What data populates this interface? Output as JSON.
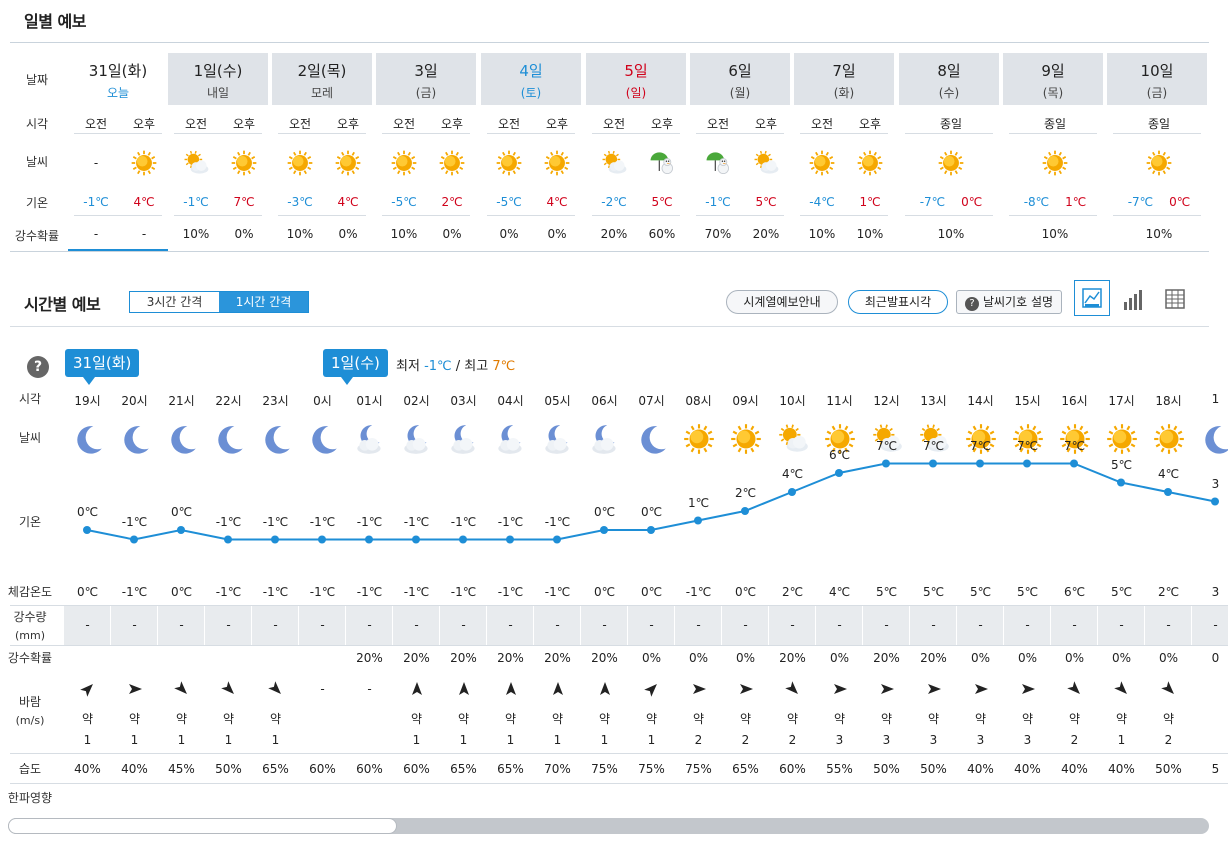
{
  "daily": {
    "title": "일별 예보",
    "labels": {
      "date": "날짜",
      "time": "시각",
      "weather": "날씨",
      "temp": "기온",
      "rain": "강수확률"
    },
    "days": [
      {
        "date": "31일(화)",
        "sub": "오늘",
        "type": "today",
        "slots": [
          {
            "t": "오전",
            "icon": "-",
            "temp": "-1℃",
            "rain": "-"
          },
          {
            "t": "오후",
            "icon": "sun",
            "temp": "4℃",
            "rain": "-"
          }
        ]
      },
      {
        "date": "1일(수)",
        "sub": "내일",
        "type": "",
        "slots": [
          {
            "t": "오전",
            "icon": "sun-cloud",
            "temp": "-1℃",
            "rain": "10%"
          },
          {
            "t": "오후",
            "icon": "sun",
            "temp": "7℃",
            "rain": "0%"
          }
        ]
      },
      {
        "date": "2일(목)",
        "sub": "모레",
        "type": "",
        "slots": [
          {
            "t": "오전",
            "icon": "sun",
            "temp": "-3℃",
            "rain": "10%"
          },
          {
            "t": "오후",
            "icon": "sun",
            "temp": "4℃",
            "rain": "0%"
          }
        ]
      },
      {
        "date": "3일",
        "sub": "(금)",
        "type": "",
        "slots": [
          {
            "t": "오전",
            "icon": "sun",
            "temp": "-5℃",
            "rain": "10%"
          },
          {
            "t": "오후",
            "icon": "sun",
            "temp": "2℃",
            "rain": "0%"
          }
        ]
      },
      {
        "date": "4일",
        "sub": "(토)",
        "type": "sat",
        "slots": [
          {
            "t": "오전",
            "icon": "sun",
            "temp": "-5℃",
            "rain": "0%"
          },
          {
            "t": "오후",
            "icon": "sun",
            "temp": "4℃",
            "rain": "0%"
          }
        ]
      },
      {
        "date": "5일",
        "sub": "(일)",
        "type": "sun",
        "slots": [
          {
            "t": "오전",
            "icon": "sun-cloud",
            "temp": "-2℃",
            "rain": "20%"
          },
          {
            "t": "오후",
            "icon": "snow-umbrella",
            "temp": "5℃",
            "rain": "60%"
          }
        ]
      },
      {
        "date": "6일",
        "sub": "(월)",
        "type": "",
        "slots": [
          {
            "t": "오전",
            "icon": "snow-umbrella",
            "temp": "-1℃",
            "rain": "70%"
          },
          {
            "t": "오후",
            "icon": "sun-cloud",
            "temp": "5℃",
            "rain": "20%"
          }
        ]
      },
      {
        "date": "7일",
        "sub": "(화)",
        "type": "",
        "slots": [
          {
            "t": "오전",
            "icon": "sun",
            "temp": "-4℃",
            "rain": "10%"
          },
          {
            "t": "오후",
            "icon": "sun",
            "temp": "1℃",
            "rain": "10%"
          }
        ]
      },
      {
        "date": "8일",
        "sub": "(수)",
        "type": "",
        "slots": [
          {
            "t": "종일",
            "icon": "sun",
            "temp": "-7℃",
            "temp2": "0℃",
            "rain": "10%"
          }
        ]
      },
      {
        "date": "9일",
        "sub": "(목)",
        "type": "",
        "slots": [
          {
            "t": "종일",
            "icon": "sun",
            "temp": "-8℃",
            "temp2": "1℃",
            "rain": "10%"
          }
        ]
      },
      {
        "date": "10일",
        "sub": "(금)",
        "type": "",
        "slots": [
          {
            "t": "종일",
            "icon": "sun",
            "temp": "-7℃",
            "temp2": "0℃",
            "rain": "10%"
          }
        ]
      }
    ]
  },
  "hourly": {
    "title": "시간별 예보",
    "tab_3h": "3시간 간격",
    "tab_1h": "1시간 간격",
    "btn_series": "시계열예보안내",
    "btn_latest": "최근발표시각",
    "btn_symbols": "날씨기호 설명",
    "help": "?",
    "bubble_today": "31일(화)",
    "bubble_tomorrow": "1일(수)",
    "min_label": "최저",
    "min_value": "-1℃",
    "slash": "/",
    "max_label": "최고",
    "max_value": "7℃",
    "labels": {
      "time": "시각",
      "weather": "날씨",
      "temp": "기온",
      "feel": "체감온도",
      "precip1": "강수량",
      "precip2": "(mm)",
      "rainprob": "강수확률",
      "wind1": "바람",
      "wind2": "(m/s)",
      "humidity": "습도",
      "cold": "한파영향"
    },
    "hours": [
      {
        "h": "19시",
        "icon": "moon",
        "temp": 0,
        "tl": "0℃",
        "feel": "0℃",
        "p": "-",
        "rp": "",
        "wd": "ne",
        "ws": "약",
        "wv": "1",
        "hum": "40%"
      },
      {
        "h": "20시",
        "icon": "moon",
        "temp": -1,
        "tl": "-1℃",
        "feel": "-1℃",
        "p": "-",
        "rp": "",
        "wd": "e",
        "ws": "약",
        "wv": "1",
        "hum": "40%"
      },
      {
        "h": "21시",
        "icon": "moon",
        "temp": 0,
        "tl": "0℃",
        "feel": "0℃",
        "p": "-",
        "rp": "",
        "wd": "se",
        "ws": "약",
        "wv": "1",
        "hum": "45%"
      },
      {
        "h": "22시",
        "icon": "moon",
        "temp": -1,
        "tl": "-1℃",
        "feel": "-1℃",
        "p": "-",
        "rp": "",
        "wd": "se",
        "ws": "약",
        "wv": "1",
        "hum": "50%"
      },
      {
        "h": "23시",
        "icon": "moon",
        "temp": -1,
        "tl": "-1℃",
        "feel": "-1℃",
        "p": "-",
        "rp": "",
        "wd": "se",
        "ws": "약",
        "wv": "1",
        "hum": "65%"
      },
      {
        "h": "0시",
        "icon": "moon",
        "temp": -1,
        "tl": "-1℃",
        "feel": "-1℃",
        "p": "-",
        "rp": "",
        "wd": "none",
        "ws": "",
        "wv": "",
        "hum": "60%"
      },
      {
        "h": "01시",
        "icon": "moon-cloud",
        "temp": -1,
        "tl": "-1℃",
        "feel": "-1℃",
        "p": "-",
        "rp": "20%",
        "wd": "none",
        "ws": "",
        "wv": "",
        "hum": "60%"
      },
      {
        "h": "02시",
        "icon": "moon-cloud",
        "temp": -1,
        "tl": "-1℃",
        "feel": "-1℃",
        "p": "-",
        "rp": "20%",
        "wd": "n",
        "ws": "약",
        "wv": "1",
        "hum": "60%"
      },
      {
        "h": "03시",
        "icon": "moon-cloud",
        "temp": -1,
        "tl": "-1℃",
        "feel": "-1℃",
        "p": "-",
        "rp": "20%",
        "wd": "n",
        "ws": "약",
        "wv": "1",
        "hum": "65%"
      },
      {
        "h": "04시",
        "icon": "moon-cloud",
        "temp": -1,
        "tl": "-1℃",
        "feel": "-1℃",
        "p": "-",
        "rp": "20%",
        "wd": "n",
        "ws": "약",
        "wv": "1",
        "hum": "65%"
      },
      {
        "h": "05시",
        "icon": "moon-cloud",
        "temp": -1,
        "tl": "-1℃",
        "feel": "-1℃",
        "p": "-",
        "rp": "20%",
        "wd": "n",
        "ws": "약",
        "wv": "1",
        "hum": "70%"
      },
      {
        "h": "06시",
        "icon": "moon-cloud",
        "temp": 0,
        "tl": "0℃",
        "feel": "0℃",
        "p": "-",
        "rp": "20%",
        "wd": "n",
        "ws": "약",
        "wv": "1",
        "hum": "75%"
      },
      {
        "h": "07시",
        "icon": "moon",
        "temp": 0,
        "tl": "0℃",
        "feel": "0℃",
        "p": "-",
        "rp": "0%",
        "wd": "ne",
        "ws": "약",
        "wv": "1",
        "hum": "75%"
      },
      {
        "h": "08시",
        "icon": "sun",
        "temp": 1,
        "tl": "1℃",
        "feel": "-1℃",
        "p": "-",
        "rp": "0%",
        "wd": "e",
        "ws": "약",
        "wv": "2",
        "hum": "75%"
      },
      {
        "h": "09시",
        "icon": "sun",
        "temp": 2,
        "tl": "2℃",
        "feel": "0℃",
        "p": "-",
        "rp": "0%",
        "wd": "e",
        "ws": "약",
        "wv": "2",
        "hum": "65%"
      },
      {
        "h": "10시",
        "icon": "sun-cloud",
        "temp": 4,
        "tl": "4℃",
        "feel": "2℃",
        "p": "-",
        "rp": "20%",
        "wd": "se",
        "ws": "약",
        "wv": "2",
        "hum": "60%"
      },
      {
        "h": "11시",
        "icon": "sun",
        "temp": 6,
        "tl": "6℃",
        "feel": "4℃",
        "p": "-",
        "rp": "0%",
        "wd": "e",
        "ws": "약",
        "wv": "3",
        "hum": "55%"
      },
      {
        "h": "12시",
        "icon": "sun-cloud",
        "temp": 7,
        "tl": "7℃",
        "feel": "5℃",
        "p": "-",
        "rp": "20%",
        "wd": "e",
        "ws": "약",
        "wv": "3",
        "hum": "50%"
      },
      {
        "h": "13시",
        "icon": "sun-cloud",
        "temp": 7,
        "tl": "7℃",
        "feel": "5℃",
        "p": "-",
        "rp": "20%",
        "wd": "e",
        "ws": "약",
        "wv": "3",
        "hum": "50%"
      },
      {
        "h": "14시",
        "icon": "sun",
        "temp": 7,
        "tl": "7℃",
        "feel": "5℃",
        "p": "-",
        "rp": "0%",
        "wd": "e",
        "ws": "약",
        "wv": "3",
        "hum": "40%"
      },
      {
        "h": "15시",
        "icon": "sun",
        "temp": 7,
        "tl": "7℃",
        "feel": "5℃",
        "p": "-",
        "rp": "0%",
        "wd": "e",
        "ws": "약",
        "wv": "3",
        "hum": "40%"
      },
      {
        "h": "16시",
        "icon": "sun",
        "temp": 7,
        "tl": "7℃",
        "feel": "6℃",
        "p": "-",
        "rp": "0%",
        "wd": "se",
        "ws": "약",
        "wv": "2",
        "hum": "40%"
      },
      {
        "h": "17시",
        "icon": "sun",
        "temp": 5,
        "tl": "5℃",
        "feel": "5℃",
        "p": "-",
        "rp": "0%",
        "wd": "se",
        "ws": "약",
        "wv": "1",
        "hum": "40%"
      },
      {
        "h": "18시",
        "icon": "sun",
        "temp": 4,
        "tl": "4℃",
        "feel": "2℃",
        "p": "-",
        "rp": "0%",
        "wd": "se",
        "ws": "약",
        "wv": "2",
        "hum": "50%"
      },
      {
        "h": "1",
        "icon": "moon",
        "temp": 3,
        "tl": "3",
        "feel": "3",
        "p": "-",
        "rp": "0",
        "wd": "none",
        "ws": "",
        "wv": "",
        "hum": "5"
      }
    ]
  },
  "colors": {
    "accent": "#1e8ed6",
    "cold": "#1e8ed6",
    "warm": "#d0021b",
    "sun": "#f5a800",
    "moon": "#6b8fd4"
  }
}
